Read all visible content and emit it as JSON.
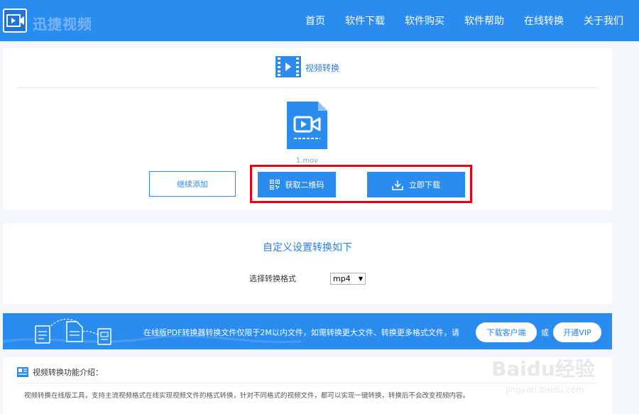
{
  "header": {
    "logo_text": "迅捷视频",
    "nav": [
      "首页",
      "软件下载",
      "软件购买",
      "软件帮助",
      "在线转换",
      "关于我们"
    ]
  },
  "converter": {
    "title": "视频转换",
    "file_name": "1.mov",
    "buttons": {
      "add_more": "继续添加",
      "get_qr": "获取二维码",
      "download": "立即下载"
    }
  },
  "settings": {
    "title": "自定义设置转换如下",
    "format_label": "选择转换格式",
    "format_value": "mp4"
  },
  "banner": {
    "text": "在线版PDF转换器转换文件仅限于2M以内文件，如需转换更大文件、转换更多格式文件，请",
    "client_button": "下载客户端",
    "or": "或",
    "vip_button": "开通VIP"
  },
  "intro": {
    "title": "视频转换功能介绍：",
    "body": "视频转换在线版工具，支持主流视频格式在线实现视频文件的格式转换，针对不同格式的视频文件，都可以实现一键转换，转换后不会改变视频内容。"
  },
  "watermark": {
    "main": "Baidu经验",
    "sub": "jingyan.baidu.com"
  },
  "colors": {
    "primary": "#2b8cf0",
    "highlight": "#e60012"
  }
}
